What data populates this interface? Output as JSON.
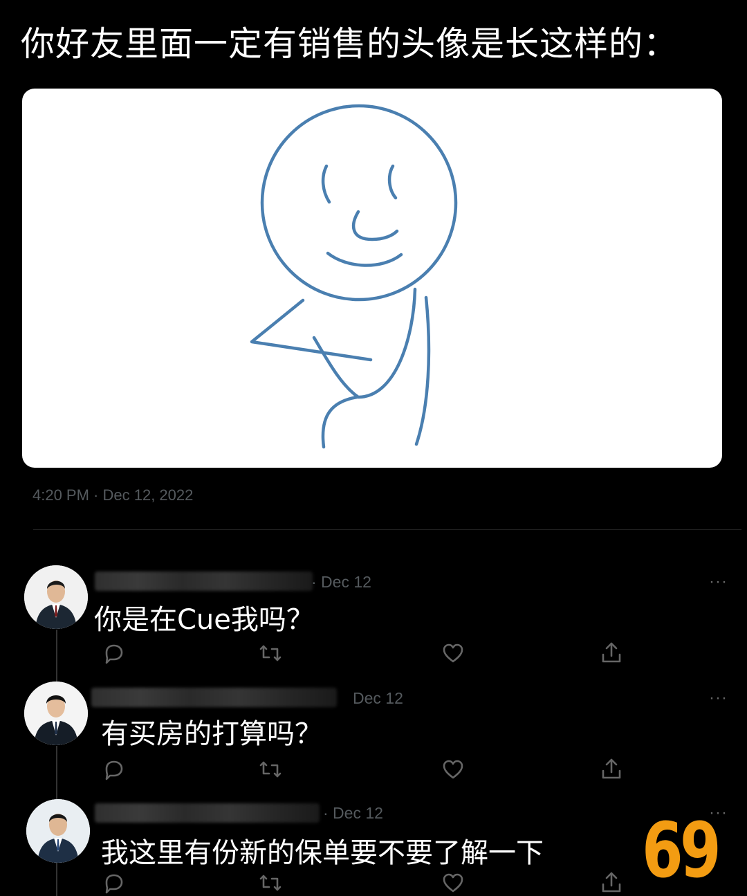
{
  "headline": "你好友里面一定有销售的头像是长这样的：",
  "post": {
    "timestamp": "4:20 PM · Dec 12, 2022"
  },
  "replies": [
    {
      "date": "· Dec 12",
      "text": "你是在Cue我吗？"
    },
    {
      "date": "Dec 12",
      "text": "有买房的打算吗？"
    },
    {
      "date": "· Dec 12",
      "text": "我这里有份新的保单要不要了解一下"
    }
  ],
  "more_label": "···",
  "badge": "69",
  "colors": {
    "background": "#000000",
    "sketch_stroke": "#4a7fb0",
    "badge": "#f39c12",
    "muted": "#555a5e"
  },
  "icons": [
    "reply-icon",
    "retweet-icon",
    "like-icon",
    "share-icon",
    "more-icon"
  ]
}
